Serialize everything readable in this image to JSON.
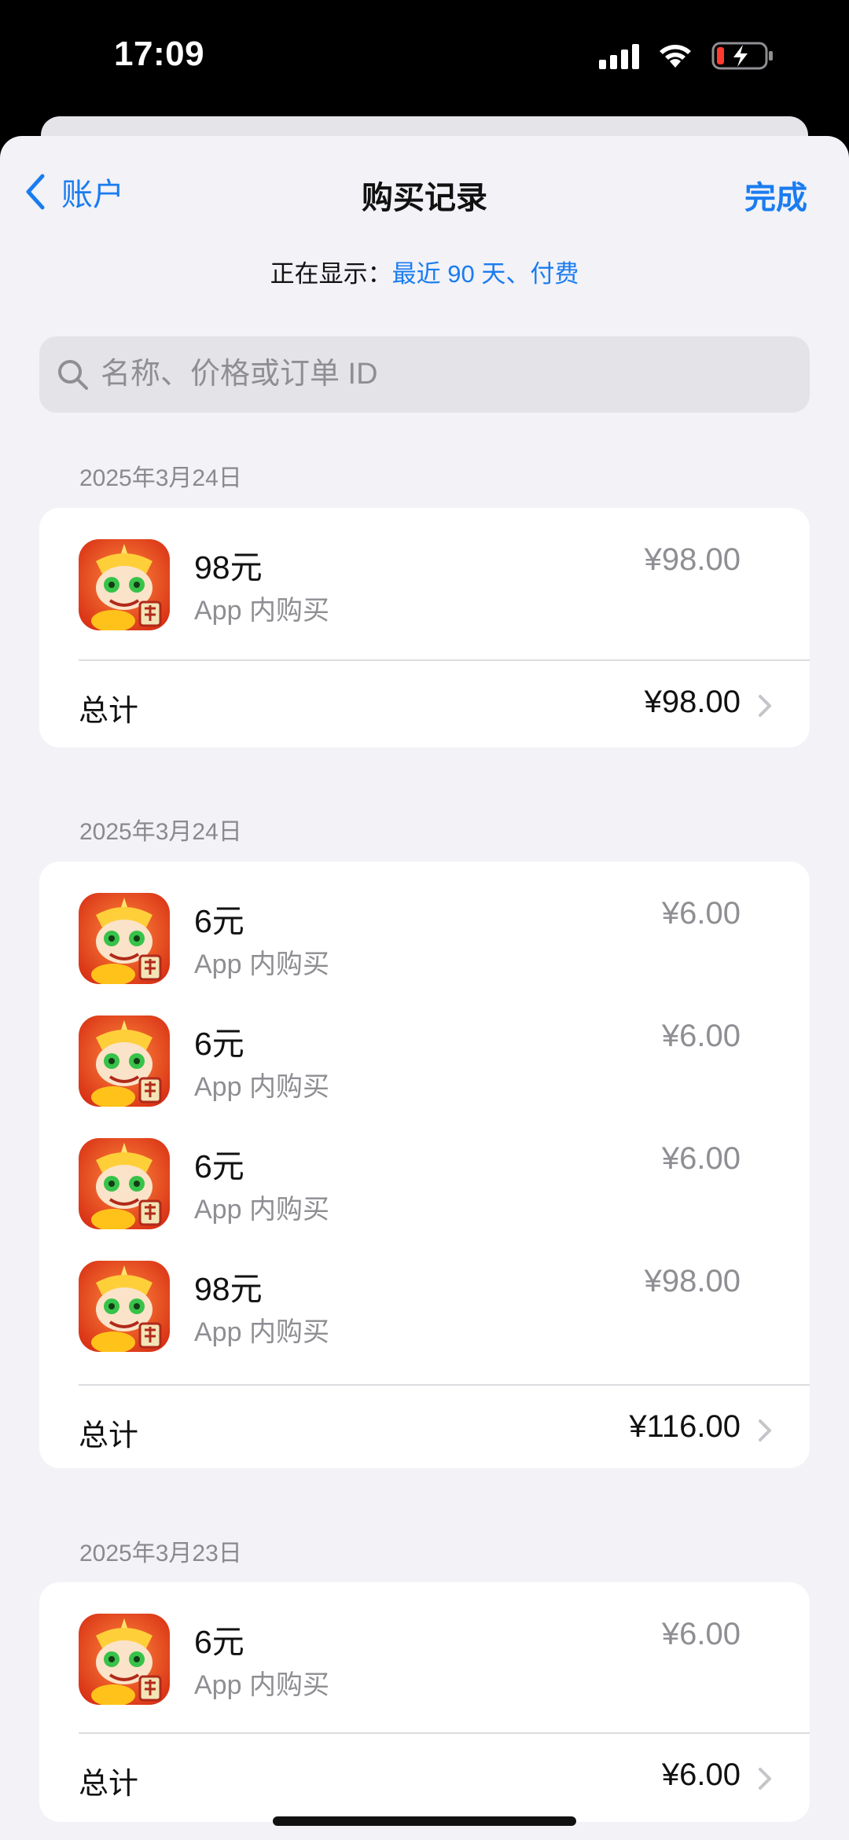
{
  "status_bar": {
    "time": "17:09",
    "icons": [
      "signal-icon",
      "wifi-icon",
      "battery-charging-icon"
    ],
    "battery_color": "#ff3b30"
  },
  "nav": {
    "back_label": "账户",
    "title": "购买记录",
    "done_label": "完成"
  },
  "filter": {
    "prefix": "正在显示：",
    "value": "最近 90 天、付费"
  },
  "search": {
    "placeholder": "名称、价格或订单 ID"
  },
  "colors": {
    "accent": "#1a7cf0",
    "background": "#f2f2f7",
    "secondary_text": "#8e8e93"
  },
  "groups": [
    {
      "date": "2025年3月24日",
      "items": [
        {
          "name": "98元",
          "type": "App 内购买",
          "price": "¥98.00"
        }
      ],
      "total_label": "总计",
      "total": "¥98.00"
    },
    {
      "date": "2025年3月24日",
      "items": [
        {
          "name": "6元",
          "type": "App 内购买",
          "price": "¥6.00"
        },
        {
          "name": "6元",
          "type": "App 内购买",
          "price": "¥6.00"
        },
        {
          "name": "6元",
          "type": "App 内购买",
          "price": "¥6.00"
        },
        {
          "name": "98元",
          "type": "App 内购买",
          "price": "¥98.00"
        }
      ],
      "total_label": "总计",
      "total": "¥116.00"
    },
    {
      "date": "2025年3月23日",
      "items": [
        {
          "name": "6元",
          "type": "App 内购买",
          "price": "¥6.00"
        }
      ],
      "total_label": "总计",
      "total": "¥6.00"
    }
  ]
}
